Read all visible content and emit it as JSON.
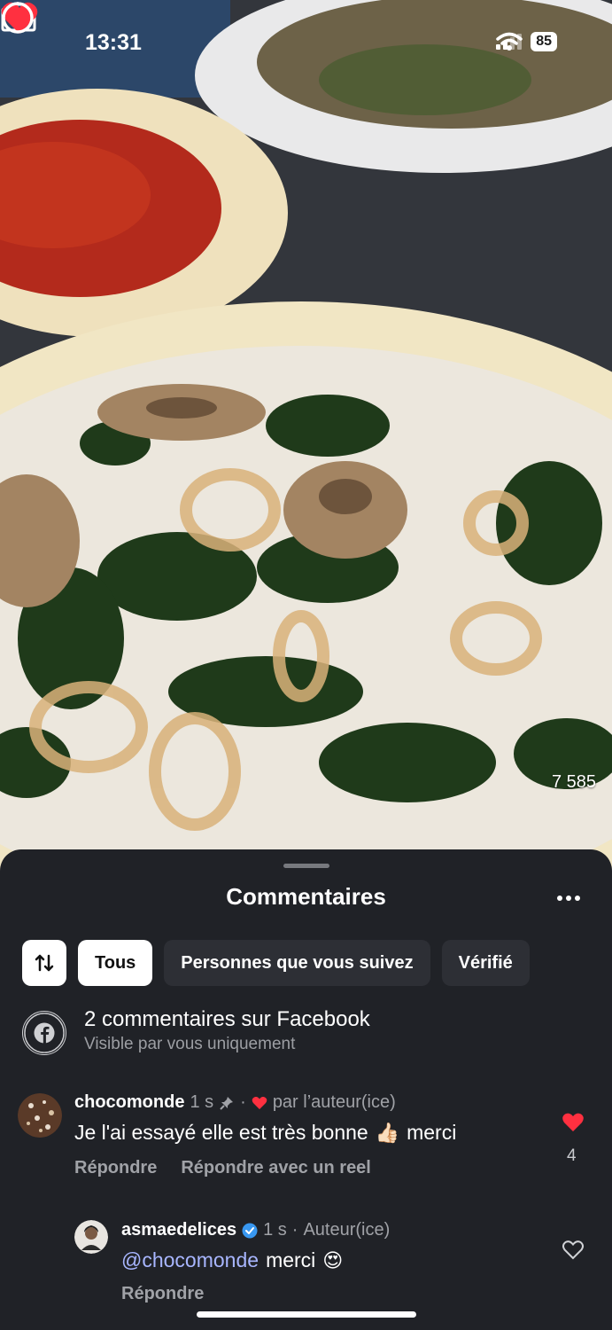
{
  "status_bar": {
    "time": "13:31",
    "battery": "85"
  },
  "reel": {
    "like_count": "7 585",
    "icons": [
      "back-arrow",
      "camera",
      "heart-filled",
      "comment-bubble"
    ]
  },
  "comments_sheet": {
    "title": "Commentaires",
    "filters": [
      "Tous",
      "Personnes que vous suivez",
      "Vérifié"
    ],
    "active_filter": "Tous",
    "facebook_notice": {
      "title": "2 commentaires sur Facebook",
      "subtitle": "Visible par vous uniquement"
    },
    "comments": [
      {
        "username": "chocomonde",
        "time": "1 s",
        "liked_by_author": "par l’auteur(ice)",
        "text": "Je l'ai essayé elle est très bonne",
        "text_after": "merci",
        "emoji": "👍🏻",
        "like_count": "4",
        "actions": [
          "Répondre",
          "Répondre avec un reel"
        ]
      },
      {
        "username": "asmaedelices",
        "time": "1 s",
        "role": "Auteur(ice)",
        "mention": "@chocomonde",
        "text": "merci",
        "emoji": "😍",
        "actions": [
          "Répondre"
        ]
      }
    ]
  },
  "colors": {
    "sheet_bg": "#202227",
    "like_red": "#ff3040",
    "mention": "#a8b6ff",
    "verified_blue": "#3897f0"
  }
}
